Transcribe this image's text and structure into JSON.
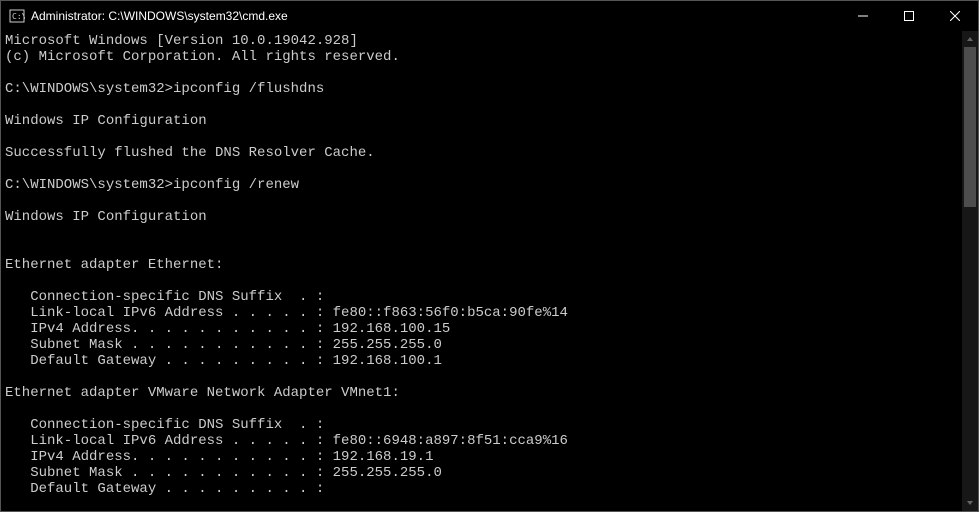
{
  "titlebar": {
    "title": "Administrator: C:\\WINDOWS\\system32\\cmd.exe"
  },
  "terminal": {
    "lines": [
      "Microsoft Windows [Version 10.0.19042.928]",
      "(c) Microsoft Corporation. All rights reserved.",
      "",
      "C:\\WINDOWS\\system32>ipconfig /flushdns",
      "",
      "Windows IP Configuration",
      "",
      "Successfully flushed the DNS Resolver Cache.",
      "",
      "C:\\WINDOWS\\system32>ipconfig /renew",
      "",
      "Windows IP Configuration",
      "",
      "",
      "Ethernet adapter Ethernet:",
      "",
      "   Connection-specific DNS Suffix  . :",
      "   Link-local IPv6 Address . . . . . : fe80::f863:56f0:b5ca:90fe%14",
      "   IPv4 Address. . . . . . . . . . . : 192.168.100.15",
      "   Subnet Mask . . . . . . . . . . . : 255.255.255.0",
      "   Default Gateway . . . . . . . . . : 192.168.100.1",
      "",
      "Ethernet adapter VMware Network Adapter VMnet1:",
      "",
      "   Connection-specific DNS Suffix  . :",
      "   Link-local IPv6 Address . . . . . : fe80::6948:a897:8f51:cca9%16",
      "   IPv4 Address. . . . . . . . . . . : 192.168.19.1",
      "   Subnet Mask . . . . . . . . . . . : 255.255.255.0",
      "   Default Gateway . . . . . . . . . :"
    ]
  }
}
